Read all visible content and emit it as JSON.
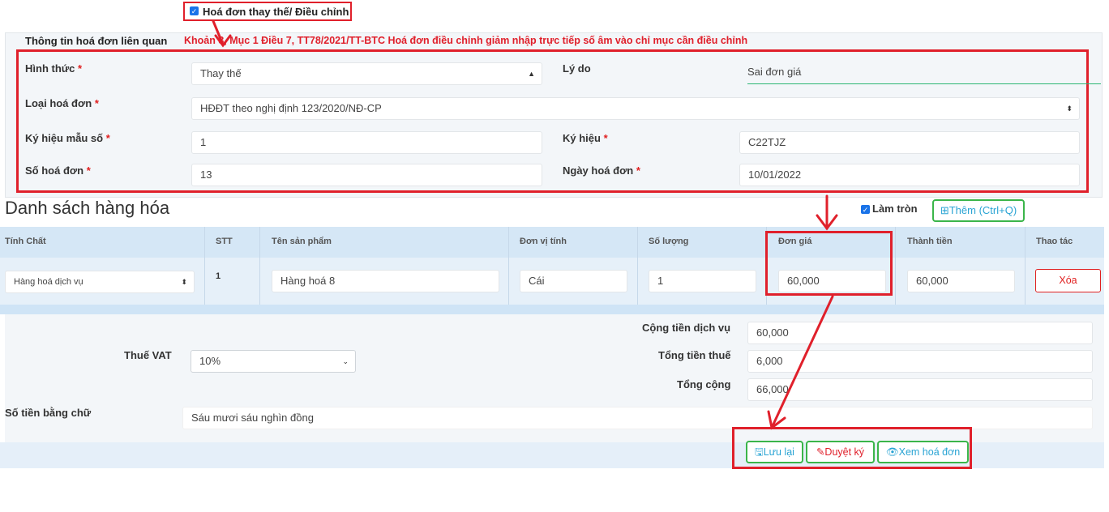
{
  "top": {
    "replace_adjust_checkbox_label": "Hoá đơn thay thế/ Điều chỉnh",
    "replace_adjust_checked": true
  },
  "related": {
    "title": "Thông tin hoá đơn liên quan",
    "note": "Khoản 3, Mục 1 Điều 7, TT78/2021/TT-BTC Hoá đơn điều chỉnh giảm nhập trực tiếp số âm vào chỉ mục cần điều chỉnh",
    "form_label": "Hình thức",
    "form_value": "Thay thế",
    "reason_label": "Lý do",
    "reason_value": "Sai đơn giá",
    "type_label": "Loại hoá đơn",
    "type_value": "HĐĐT theo nghị định 123/2020/NĐ-CP",
    "template_label": "Ký hiệu mẫu số",
    "template_value": "1",
    "symbol_label": "Ký hiệu",
    "symbol_value": "C22TJZ",
    "number_label": "Số hoá đơn",
    "number_value": "13",
    "date_label": "Ngày hoá đơn",
    "date_value": "10/01/2022",
    "required_mark": "*"
  },
  "goods": {
    "title": "Danh sách hàng hóa",
    "round_label": "Làm tròn",
    "round_checked": true,
    "add_button": "⊞Thêm (Ctrl+Q)",
    "columns": [
      "Tính Chất",
      "STT",
      "Tên sản phẩm",
      "Đơn vị tính",
      "Số lượng",
      "Đơn giá",
      "Thành tiền",
      "Thao tác"
    ],
    "rows": [
      {
        "nature": "Hàng hoá dịch vụ",
        "stt": "1",
        "name": "Hàng hoá 8",
        "unit": "Cái",
        "qty": "1",
        "price": "60,000",
        "amount": "60,000",
        "delete": "Xóa"
      }
    ]
  },
  "totals": {
    "vat_label": "Thuế VAT",
    "vat_value": "10%",
    "service_label": "Cộng tiền dịch vụ",
    "service_value": "60,000",
    "tax_label": "Tổng tiền thuế",
    "tax_value": "6,000",
    "total_label": "Tổng cộng",
    "total_value": "66,000",
    "words_label": "Số tiền bằng chữ",
    "words_value": "Sáu mươi sáu nghìn đồng"
  },
  "actions": {
    "save": "Lưu lại",
    "approve": "Duyệt ký",
    "view": "Xem hoá đơn"
  },
  "colors": {
    "highlight": "#e0202b",
    "button_border": "#3bb54a",
    "link_blue": "#2aa4d4",
    "danger": "#e02020"
  },
  "icons": [
    "checkbox-icon",
    "save-icon",
    "sign-icon",
    "eye-icon",
    "plus-square-icon",
    "sort-arrows-icon",
    "chevron-down-icon"
  ]
}
